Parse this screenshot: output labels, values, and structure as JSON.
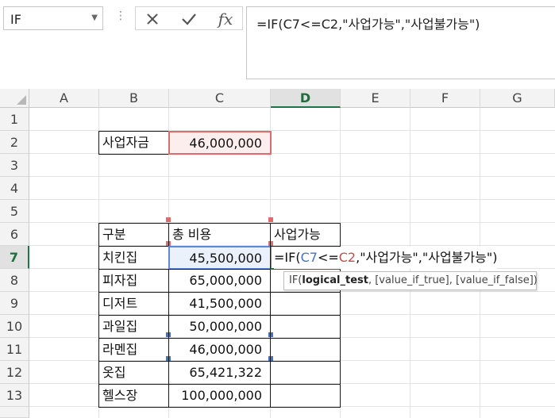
{
  "name_box": "IF",
  "formula_bar": {
    "text": "=IF(C7<=C2,\"사업가능\",\"사업불가능\")",
    "cancel_icon": "close-icon",
    "enter_icon": "check-icon",
    "function_icon": "fx-icon",
    "fx_label": "fx"
  },
  "columns": [
    "A",
    "B",
    "C",
    "D",
    "E",
    "F",
    "G"
  ],
  "rows": [
    "1",
    "2",
    "3",
    "4",
    "5",
    "6",
    "7",
    "8",
    "9",
    "10",
    "11",
    "12",
    "13"
  ],
  "cells": {
    "B2": "사업자금",
    "C2": "46,000,000",
    "B6": "구분",
    "C6": "총 비용",
    "D6": "사업가능",
    "table": [
      {
        "name": "치킨집",
        "cost": "45,500,000"
      },
      {
        "name": "피자집",
        "cost": "65,000,000"
      },
      {
        "name": "디저트",
        "cost": "41,500,000"
      },
      {
        "name": "과일집",
        "cost": "50,000,000"
      },
      {
        "name": "라멘집",
        "cost": "46,000,000"
      },
      {
        "name": "옷집",
        "cost": "65,421,322"
      },
      {
        "name": "헬스장",
        "cost": "100,000,000"
      }
    ]
  },
  "edit_cell": {
    "prefix": "=IF(",
    "ref1": "C7",
    "op": "<=",
    "ref2": "C2",
    "suffix": ",\"사업가능\",\"사업불가능\")"
  },
  "tooltip": {
    "fn": "IF(",
    "arg1": "logical_test",
    "rest": ", [value_if_true], [value_if_false])"
  },
  "colors": {
    "accent": "#217346",
    "ref_blue": "#4472c4",
    "ref_red": "#c0504d"
  }
}
